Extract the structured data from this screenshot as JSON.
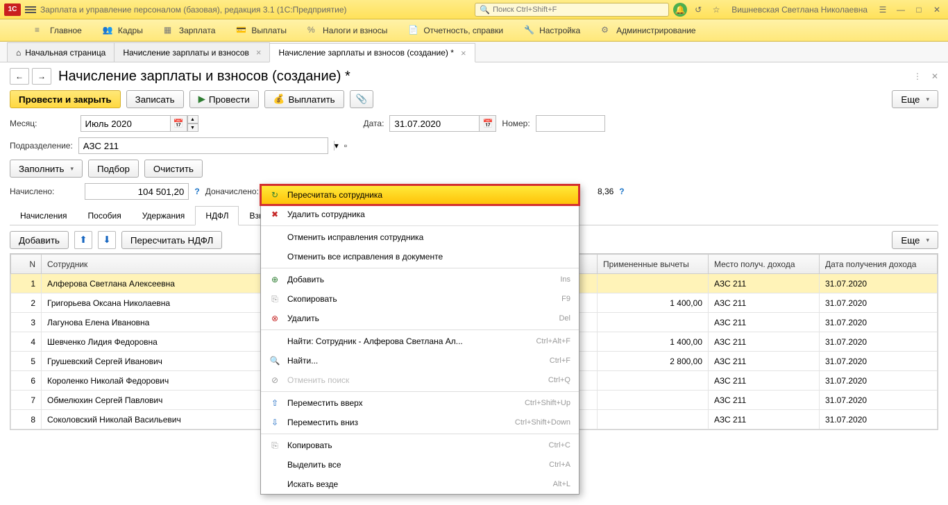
{
  "app": {
    "title": "Зарплата и управление персоналом (базовая), редакция 3.1  (1С:Предприятие)",
    "search_placeholder": "Поиск Ctrl+Shift+F",
    "username": "Вишневская Светлана Николаевна"
  },
  "mainnav": [
    {
      "icon": "≡",
      "label": "Главное"
    },
    {
      "icon": "👥",
      "label": "Кадры"
    },
    {
      "icon": "▦",
      "label": "Зарплата"
    },
    {
      "icon": "💳",
      "label": "Выплаты"
    },
    {
      "icon": "%",
      "label": "Налоги и взносы"
    },
    {
      "icon": "📄",
      "label": "Отчетность, справки"
    },
    {
      "icon": "🔧",
      "label": "Настройка"
    },
    {
      "icon": "⚙",
      "label": "Администрирование"
    }
  ],
  "tabs": [
    {
      "label": "Начальная страница",
      "home": true
    },
    {
      "label": "Начисление зарплаты и взносов",
      "close": true
    },
    {
      "label": "Начисление зарплаты и взносов (создание) *",
      "close": true,
      "active": true
    }
  ],
  "page": {
    "title": "Начисление зарплаты и взносов (создание) *",
    "toolbar": {
      "post_close": "Провести и закрыть",
      "save": "Записать",
      "post": "Провести",
      "pay": "Выплатить",
      "more": "Еще"
    },
    "fields": {
      "month_label": "Месяц:",
      "month_value": "Июль 2020",
      "date_label": "Дата:",
      "date_value": "31.07.2020",
      "number_label": "Номер:",
      "number_value": "",
      "dept_label": "Подразделение:",
      "dept_value": "АЗС 211",
      "fill": "Заполнить",
      "select": "Подбор",
      "clear": "Очистить",
      "accrued_label": "Начислено:",
      "accrued_value": "104 501,20",
      "extra_label": "Доначислено:",
      "partial": "8,36"
    },
    "inner_tabs": [
      "Начисления",
      "Пособия",
      "Удержания",
      "НДФЛ",
      "Взнос"
    ],
    "inner_active": 3,
    "sub_toolbar": {
      "add": "Добавить",
      "recalc": "Пересчитать НДФЛ",
      "more": "Еще"
    },
    "grid": {
      "columns": [
        "N",
        "Сотрудник",
        "Примененные вычеты",
        "Место получ. дохода",
        "Дата получения дохода"
      ],
      "rows": [
        {
          "n": 1,
          "emp": "Алферова Светлана Алексеевна",
          "ded": "",
          "place": "АЗС 211",
          "date": "31.07.2020",
          "sel": true
        },
        {
          "n": 2,
          "emp": "Григорьева Оксана Николаевна",
          "ded": "1 400,00",
          "place": "АЗС 211",
          "date": "31.07.2020"
        },
        {
          "n": 3,
          "emp": "Лагунова Елена Ивановна",
          "ded": "",
          "place": "АЗС 211",
          "date": "31.07.2020"
        },
        {
          "n": 4,
          "emp": "Шевченко Лидия Федоровна",
          "ded": "1 400,00",
          "place": "АЗС 211",
          "date": "31.07.2020"
        },
        {
          "n": 5,
          "emp": "Грушевский Сергей Иванович",
          "ded": "2 800,00",
          "place": "АЗС 211",
          "date": "31.07.2020"
        },
        {
          "n": 6,
          "emp": "Короленко Николай Федорович",
          "ded": "",
          "place": "АЗС 211",
          "date": "31.07.2020"
        },
        {
          "n": 7,
          "emp": "Обмелюхин Сергей Павлович",
          "ded": "",
          "place": "АЗС 211",
          "date": "31.07.2020"
        },
        {
          "n": 8,
          "emp": "Соколовский Николай Васильевич",
          "ded": "",
          "place": "АЗС 211",
          "date": "31.07.2020"
        }
      ]
    }
  },
  "context_menu": [
    {
      "icon": "↻",
      "icon_cls": "ic-green",
      "label": "Пересчитать сотрудника",
      "highlighted": true
    },
    {
      "icon": "✖",
      "icon_cls": "ic-red",
      "label": "Удалить сотрудника"
    },
    {
      "sep": true
    },
    {
      "icon": "",
      "label": "Отменить исправления сотрудника"
    },
    {
      "icon": "",
      "label": "Отменить все исправления в документе"
    },
    {
      "sep": true
    },
    {
      "icon": "⊕",
      "icon_cls": "ic-green",
      "label": "Добавить",
      "shortcut": "Ins"
    },
    {
      "icon": "⎘",
      "icon_cls": "ic-gray",
      "label": "Скопировать",
      "shortcut": "F9"
    },
    {
      "icon": "⊗",
      "icon_cls": "ic-red",
      "label": "Удалить",
      "shortcut": "Del"
    },
    {
      "sep": true
    },
    {
      "icon": "",
      "label": "Найти: Сотрудник - Алферова Светлана Ал...",
      "shortcut": "Ctrl+Alt+F"
    },
    {
      "icon": "🔍",
      "icon_cls": "ic-gray",
      "label": "Найти...",
      "shortcut": "Ctrl+F"
    },
    {
      "icon": "⊘",
      "icon_cls": "ic-gray",
      "label": "Отменить поиск",
      "shortcut": "Ctrl+Q",
      "disabled": true
    },
    {
      "sep": true
    },
    {
      "icon": "⇧",
      "icon_cls": "ic-blue",
      "label": "Переместить вверх",
      "shortcut": "Ctrl+Shift+Up"
    },
    {
      "icon": "⇩",
      "icon_cls": "ic-blue",
      "label": "Переместить вниз",
      "shortcut": "Ctrl+Shift+Down"
    },
    {
      "sep": true
    },
    {
      "icon": "⎘",
      "icon_cls": "ic-gray",
      "label": "Копировать",
      "shortcut": "Ctrl+C"
    },
    {
      "icon": "",
      "label": "Выделить все",
      "shortcut": "Ctrl+A"
    },
    {
      "icon": "",
      "label": "Искать везде",
      "shortcut": "Alt+L"
    }
  ]
}
